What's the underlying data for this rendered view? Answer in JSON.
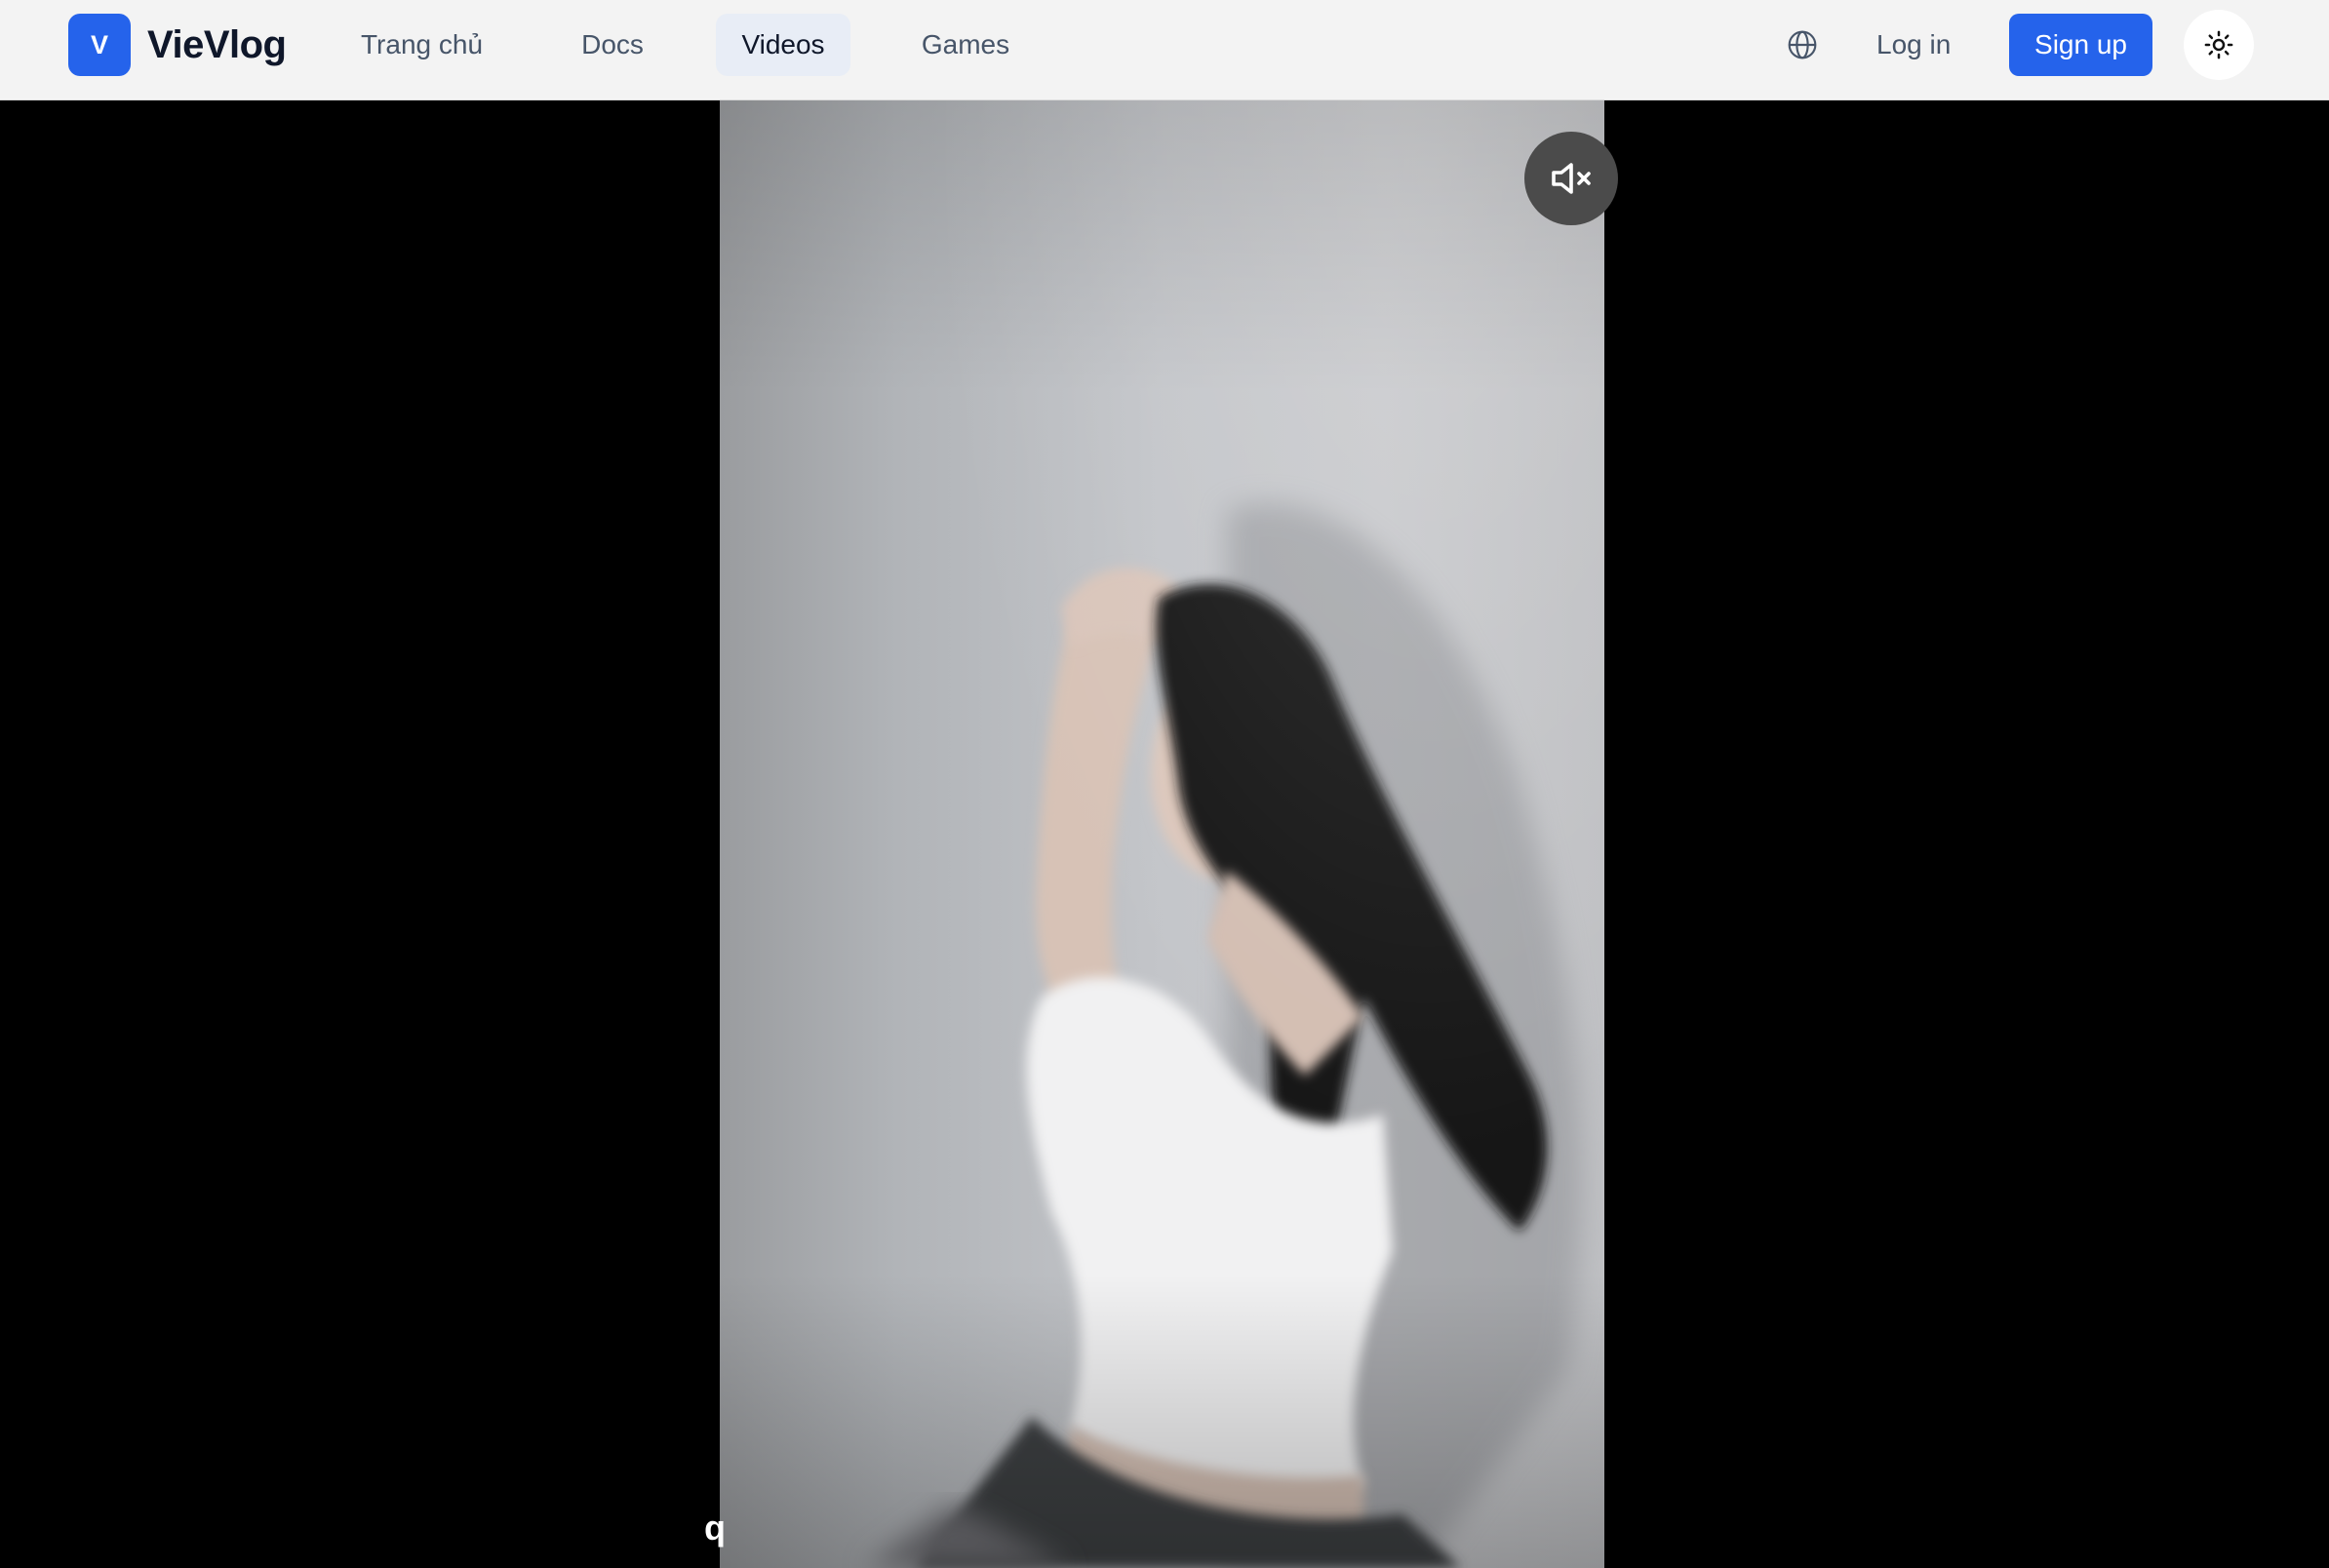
{
  "header": {
    "logo_letter": "V",
    "brand": "VieVlog",
    "nav": [
      {
        "label": "Trang chủ",
        "active": false
      },
      {
        "label": "Docs",
        "active": false
      },
      {
        "label": "Videos",
        "active": true
      },
      {
        "label": "Games",
        "active": false
      }
    ],
    "language_icon": "globe-icon",
    "login_label": "Log in",
    "signup_label": "Sign up",
    "theme_icon": "sun-icon"
  },
  "player": {
    "mute_icon": "speaker-muted-icon",
    "muted": true,
    "caption": "q"
  },
  "colors": {
    "accent": "#2563eb",
    "navbar_bg": "#f3f3f3",
    "page_bg": "#000000"
  }
}
